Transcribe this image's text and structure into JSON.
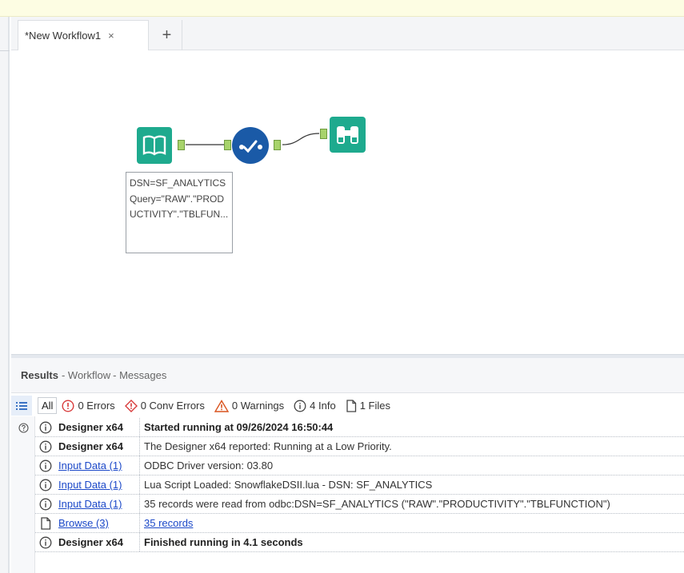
{
  "tabs": [
    {
      "label": "*New Workflow1",
      "close": "×"
    }
  ],
  "add_tab_label": "+",
  "annotation": "DSN=SF_ANALYTICS Query=\"RAW\".\"PRODUCTIVITY\".\"TBLFUN...",
  "results": {
    "title": "Results",
    "crumbs": [
      "- Workflow",
      "- Messages"
    ]
  },
  "filters": {
    "all": "All",
    "errors": "0 Errors",
    "conv_errors": "0 Conv Errors",
    "warnings": "0 Warnings",
    "info": "4 Info",
    "files": "1 Files"
  },
  "colors": {
    "tool_green": "#1eaa8e",
    "tool_blue": "#1a5aa7",
    "link": "#1b48c8",
    "error_red": "#d83b3b",
    "warning_orange": "#d9531e"
  },
  "messages": [
    {
      "icon": "info-icon",
      "source": "Designer x64",
      "text": "Started running at 09/26/2024 16:50:44"
    },
    {
      "icon": "info-icon",
      "source": "Designer x64",
      "text": "The Designer x64 reported: Running at a Low Priority."
    },
    {
      "icon": "info-icon",
      "source": "Input Data (1)",
      "text": "ODBC Driver version: 03.80"
    },
    {
      "icon": "info-icon",
      "source": "Input Data (1)",
      "text": "Lua Script Loaded: SnowflakeDSII.lua - DSN: SF_ANALYTICS"
    },
    {
      "icon": "info-icon",
      "source": "Input Data (1)",
      "text": "35 records were read from odbc:DSN=SF_ANALYTICS (\"RAW\".\"PRODUCTIVITY\".\"TBLFUNCTION\")"
    },
    {
      "icon": "file-icon",
      "source": "Browse (3)",
      "text": "35 records"
    },
    {
      "icon": "info-icon",
      "source": "Designer x64",
      "text": "Finished running in 4.1 seconds"
    }
  ]
}
